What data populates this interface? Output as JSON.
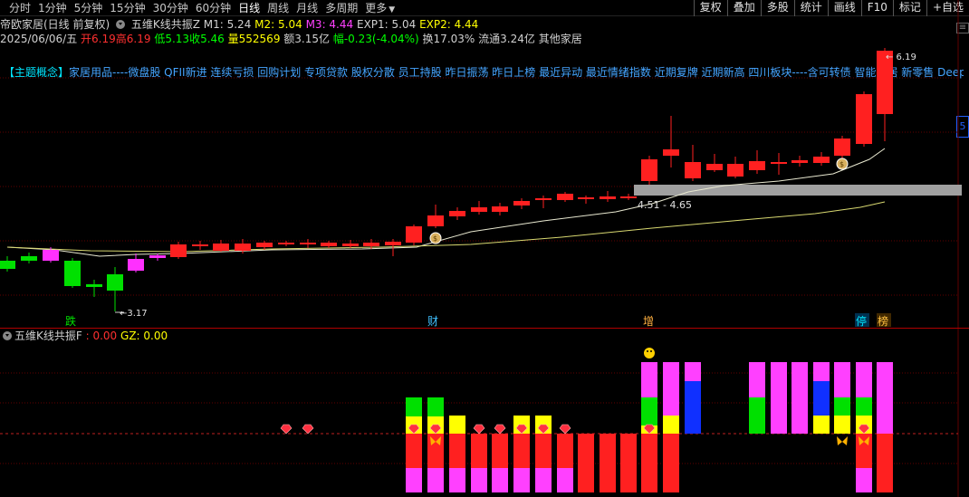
{
  "topbar": {
    "periods": [
      "分时",
      "1分钟",
      "5分钟",
      "15分钟",
      "30分钟",
      "60分钟",
      "日线",
      "周线",
      "月线",
      "多周期",
      "更多"
    ],
    "active_period": "日线",
    "tools": [
      "复权",
      "叠加",
      "多股",
      "统计",
      "画线",
      "F10",
      "标记",
      "+自选"
    ]
  },
  "header": {
    "title": "帝欧家居(日线 前复权)",
    "indicator_name": "五维K线共振Z",
    "m1": "M1: 5.24",
    "m2": "M2: 5.04",
    "m3": "M3: 4.44",
    "exp1": "EXP1: 5.04",
    "exp2": "EXP2: 4.44"
  },
  "quote": {
    "date": "2025/06/06/五",
    "open": "开6.19",
    "high": "高6.19",
    "low": "低5.13",
    "close": "收5.46",
    "volume": "量552569",
    "amount": "额3.15亿",
    "change": "幅-0.23(-4.04%)",
    "turnover": "换17.03%",
    "float": "流通3.24亿",
    "sector": "其他家居"
  },
  "concept": {
    "lead": "【主题概念】",
    "text": "家居用品----微盘股 QFII新进 连续亏损 回购计划 专项贷款 股权分散 员工持股 昨日振荡 昨日上榜 最近异动 最近情绪指数 近期复牌 近期新高 四川板块----含可转债 智能家居 新零售 DeepSeek"
  },
  "chart_labels": {
    "high_mark": "6.19",
    "low_mark": "3.17",
    "band_label": "4.51 - 4.65",
    "tag_die": "跌",
    "tag_cai": "财",
    "tag_zeng": "增",
    "tag_ting": "停",
    "tag_bang": "榜",
    "right_tab_top": "≡",
    "right_tab_5": "5"
  },
  "lower_pane": {
    "title": "五维K线共振F",
    "value": ": 0.00",
    "gz": "GZ: 0.00"
  },
  "colors": {
    "up": "#ff2020",
    "down": "#00e000",
    "magenta": "#ff30ff",
    "ma_white": "#e8e8d0",
    "ma_yellow": "#d8d870",
    "band": "#a0a0a0",
    "blue": "#1030ff",
    "yellow": "#ffff00",
    "pink": "#ff40ff"
  }
}
